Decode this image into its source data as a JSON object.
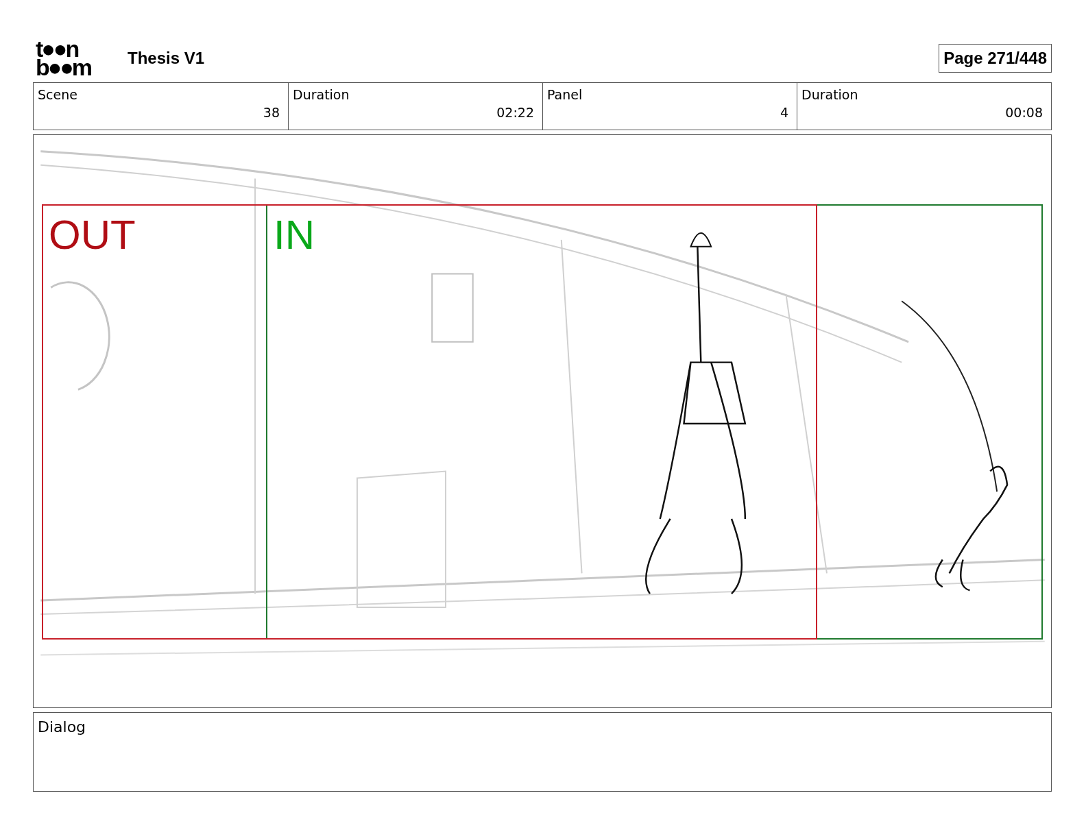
{
  "header": {
    "logo": [
      "t●●n",
      "b●●m"
    ],
    "title": "Thesis V1",
    "page": "Page 271/448"
  },
  "info": [
    {
      "label": "Scene",
      "value": "38"
    },
    {
      "label": "Duration",
      "value": "02:22"
    },
    {
      "label": "Panel",
      "value": "4"
    },
    {
      "label": "Duration",
      "value": "00:08"
    }
  ],
  "panel": {
    "markers": [
      {
        "kind": "out",
        "label": "OUT"
      },
      {
        "kind": "in",
        "label": "IN"
      }
    ]
  },
  "dialog": {
    "label": "Dialog"
  }
}
